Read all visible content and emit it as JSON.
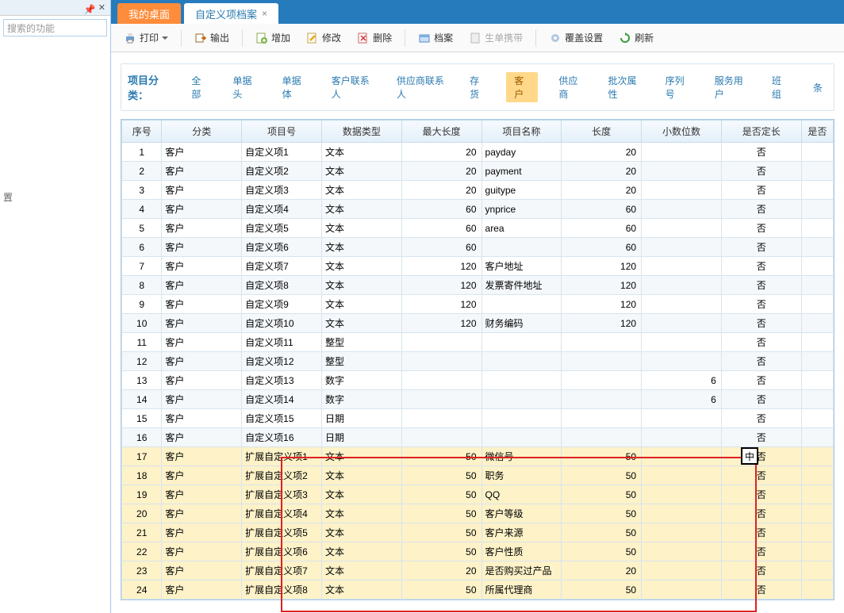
{
  "sidebar": {
    "search_placeholder": "搜索的功能",
    "items": [
      {
        "label": ""
      },
      {
        "label": ""
      },
      {
        "label": "置"
      }
    ]
  },
  "tabs": [
    {
      "label": "我的桌面",
      "active": false
    },
    {
      "label": "自定义项档案",
      "active": true
    }
  ],
  "toolbar": {
    "print": "打印",
    "export": "输出",
    "add": "增加",
    "edit": "修改",
    "delete": "删除",
    "archive": "档案",
    "carry": "生单携带",
    "cover": "覆盖设置",
    "refresh": "刷新"
  },
  "category": {
    "label": "项目分类：",
    "items": [
      "全部",
      "单据头",
      "单据体",
      "客户联系人",
      "供应商联系人",
      "存货",
      "客户",
      "供应商",
      "批次属性",
      "序列号",
      "服务用户",
      "班组",
      "条"
    ],
    "active_index": 6
  },
  "columns": [
    "序号",
    "分类",
    "项目号",
    "数据类型",
    "最大长度",
    "项目名称",
    "长度",
    "小数位数",
    "是否定长",
    "是否"
  ],
  "rows": [
    {
      "seq": 1,
      "cat": "客户",
      "proj": "自定义项1",
      "dtype": "文本",
      "maxlen": "20",
      "name": "payday",
      "len": "20",
      "dec": "",
      "fixed": "否",
      "hi": false
    },
    {
      "seq": 2,
      "cat": "客户",
      "proj": "自定义项2",
      "dtype": "文本",
      "maxlen": "20",
      "name": "payment",
      "len": "20",
      "dec": "",
      "fixed": "否",
      "hi": false
    },
    {
      "seq": 3,
      "cat": "客户",
      "proj": "自定义项3",
      "dtype": "文本",
      "maxlen": "20",
      "name": "guitype",
      "len": "20",
      "dec": "",
      "fixed": "否",
      "hi": false
    },
    {
      "seq": 4,
      "cat": "客户",
      "proj": "自定义项4",
      "dtype": "文本",
      "maxlen": "60",
      "name": "ynprice",
      "len": "60",
      "dec": "",
      "fixed": "否",
      "hi": false
    },
    {
      "seq": 5,
      "cat": "客户",
      "proj": "自定义项5",
      "dtype": "文本",
      "maxlen": "60",
      "name": "area",
      "len": "60",
      "dec": "",
      "fixed": "否",
      "hi": false
    },
    {
      "seq": 6,
      "cat": "客户",
      "proj": "自定义项6",
      "dtype": "文本",
      "maxlen": "60",
      "name": "",
      "len": "60",
      "dec": "",
      "fixed": "否",
      "hi": false
    },
    {
      "seq": 7,
      "cat": "客户",
      "proj": "自定义项7",
      "dtype": "文本",
      "maxlen": "120",
      "name": "客户地址",
      "len": "120",
      "dec": "",
      "fixed": "否",
      "hi": false
    },
    {
      "seq": 8,
      "cat": "客户",
      "proj": "自定义项8",
      "dtype": "文本",
      "maxlen": "120",
      "name": "发票寄件地址",
      "len": "120",
      "dec": "",
      "fixed": "否",
      "hi": false
    },
    {
      "seq": 9,
      "cat": "客户",
      "proj": "自定义项9",
      "dtype": "文本",
      "maxlen": "120",
      "name": "",
      "len": "120",
      "dec": "",
      "fixed": "否",
      "hi": false
    },
    {
      "seq": 10,
      "cat": "客户",
      "proj": "自定义项10",
      "dtype": "文本",
      "maxlen": "120",
      "name": "财务编码",
      "len": "120",
      "dec": "",
      "fixed": "否",
      "hi": false
    },
    {
      "seq": 11,
      "cat": "客户",
      "proj": "自定义项11",
      "dtype": "整型",
      "maxlen": "",
      "name": "",
      "len": "",
      "dec": "",
      "fixed": "否",
      "hi": false
    },
    {
      "seq": 12,
      "cat": "客户",
      "proj": "自定义项12",
      "dtype": "整型",
      "maxlen": "",
      "name": "",
      "len": "",
      "dec": "",
      "fixed": "否",
      "hi": false
    },
    {
      "seq": 13,
      "cat": "客户",
      "proj": "自定义项13",
      "dtype": "数字",
      "maxlen": "",
      "name": "",
      "len": "",
      "dec": "6",
      "fixed": "否",
      "hi": false
    },
    {
      "seq": 14,
      "cat": "客户",
      "proj": "自定义项14",
      "dtype": "数字",
      "maxlen": "",
      "name": "",
      "len": "",
      "dec": "6",
      "fixed": "否",
      "hi": false
    },
    {
      "seq": 15,
      "cat": "客户",
      "proj": "自定义项15",
      "dtype": "日期",
      "maxlen": "",
      "name": "",
      "len": "",
      "dec": "",
      "fixed": "否",
      "hi": false
    },
    {
      "seq": 16,
      "cat": "客户",
      "proj": "自定义项16",
      "dtype": "日期",
      "maxlen": "",
      "name": "",
      "len": "",
      "dec": "",
      "fixed": "否",
      "hi": false
    },
    {
      "seq": 17,
      "cat": "客户",
      "proj": "扩展自定义项1",
      "dtype": "文本",
      "maxlen": "50",
      "name": "微信号",
      "len": "50",
      "dec": "",
      "fixed": "否",
      "hi": true
    },
    {
      "seq": 18,
      "cat": "客户",
      "proj": "扩展自定义项2",
      "dtype": "文本",
      "maxlen": "50",
      "name": "职务",
      "len": "50",
      "dec": "",
      "fixed": "否",
      "hi": true
    },
    {
      "seq": 19,
      "cat": "客户",
      "proj": "扩展自定义项3",
      "dtype": "文本",
      "maxlen": "50",
      "name": "QQ",
      "len": "50",
      "dec": "",
      "fixed": "否",
      "hi": true
    },
    {
      "seq": 20,
      "cat": "客户",
      "proj": "扩展自定义项4",
      "dtype": "文本",
      "maxlen": "50",
      "name": "客户等级",
      "len": "50",
      "dec": "",
      "fixed": "否",
      "hi": true
    },
    {
      "seq": 21,
      "cat": "客户",
      "proj": "扩展自定义项5",
      "dtype": "文本",
      "maxlen": "50",
      "name": "客户来源",
      "len": "50",
      "dec": "",
      "fixed": "否",
      "hi": true
    },
    {
      "seq": 22,
      "cat": "客户",
      "proj": "扩展自定义项6",
      "dtype": "文本",
      "maxlen": "50",
      "name": "客户性质",
      "len": "50",
      "dec": "",
      "fixed": "否",
      "hi": true
    },
    {
      "seq": 23,
      "cat": "客户",
      "proj": "扩展自定义项7",
      "dtype": "文本",
      "maxlen": "20",
      "name": "是否购买过产品",
      "len": "20",
      "dec": "",
      "fixed": "否",
      "hi": true
    },
    {
      "seq": 24,
      "cat": "客户",
      "proj": "扩展自定义项8",
      "dtype": "文本",
      "maxlen": "50",
      "name": "所属代理商",
      "len": "50",
      "dec": "",
      "fixed": "否",
      "hi": true
    }
  ],
  "cursor_label": "中"
}
